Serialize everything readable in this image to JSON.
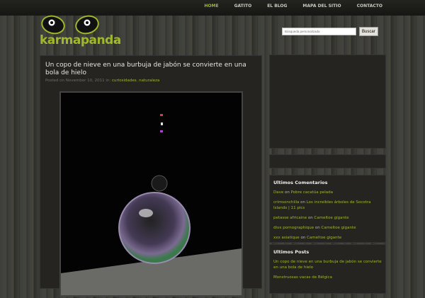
{
  "nav": {
    "items": [
      "HOME",
      "GATITO",
      "EL BLOG",
      "MAPA DEL SITIO",
      "CONTACTO"
    ]
  },
  "logo": {
    "text": "karmapanda"
  },
  "search": {
    "placeholder": "Búsqueda personalizada",
    "button": "Buscar"
  },
  "post": {
    "title": "Un copo de nieve en una burbuja de jabón se convierte en una bola de hielo",
    "posted": "Posted on November 10, 2011 in:",
    "cat1": "curiosidades",
    "sep": ",",
    "cat2": "naturaleza"
  },
  "comments": {
    "title": "Ultimos Comentarios",
    "on": "on",
    "items": [
      {
        "author": "Dave",
        "post": "Pobre cacatúa pelada"
      },
      {
        "author": "crimsonchilla",
        "post": "Los increibles árboles de Socotra Islands | 11 pics"
      },
      {
        "author": "petasse africaine",
        "post": "Cameltoe gigante"
      },
      {
        "author": "divx pornographique",
        "post": "Cameltoe gigante"
      },
      {
        "author": "xxx asiatique",
        "post": "Cameltoe gigante"
      }
    ]
  },
  "posts": {
    "title": "Ultimos Posts",
    "items": [
      "Un copo de nieve en una burbuja de jabón se convierte en una bola de hielo",
      "Monstruosas vacas de Bélgica"
    ]
  },
  "colors": {
    "accent": "#9fb82a"
  }
}
